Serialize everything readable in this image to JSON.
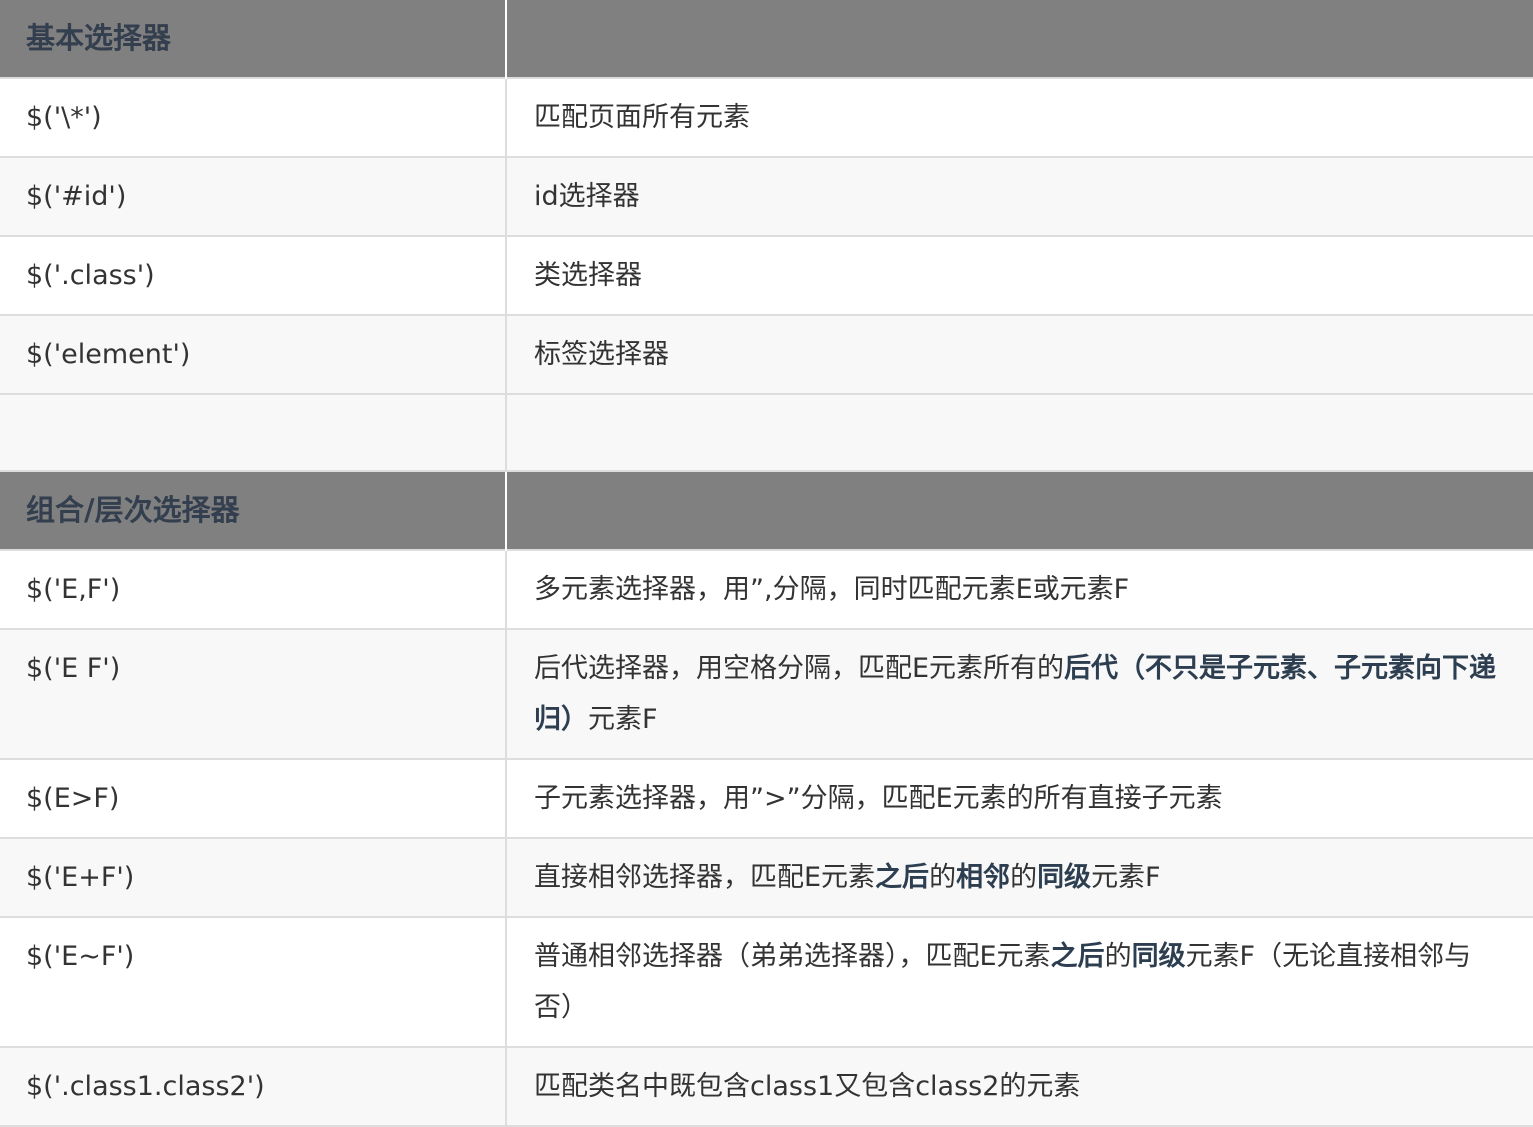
{
  "sections": [
    {
      "title": "基本选择器",
      "rows": [
        {
          "selector": "$('\\*')",
          "description": [
            {
              "text": "匹配页面所有元素",
              "bold": false
            }
          ]
        },
        {
          "selector": "$('#id')",
          "description": [
            {
              "text": "id选择器",
              "bold": false
            }
          ]
        },
        {
          "selector": "$('.class')",
          "description": [
            {
              "text": "类选择器",
              "bold": false
            }
          ]
        },
        {
          "selector": "$('element')",
          "description": [
            {
              "text": "标签选择器",
              "bold": false
            }
          ]
        }
      ]
    },
    {
      "title": "组合/层次选择器",
      "rows": [
        {
          "selector": "$('E,F')",
          "description": [
            {
              "text": "多元素选择器，用”,分隔，同时匹配元素E或元素F",
              "bold": false
            }
          ]
        },
        {
          "selector": "$('E F')",
          "description": [
            {
              "text": "后代选择器，用空格分隔，匹配E元素所有的",
              "bold": false
            },
            {
              "text": "后代（不只是子元素、子元素向下递归）",
              "bold": true
            },
            {
              "text": "元素F",
              "bold": false
            }
          ]
        },
        {
          "selector": "$(E>F)",
          "description": [
            {
              "text": "子元素选择器，用”>”分隔，匹配E元素的所有直接子元素",
              "bold": false
            }
          ]
        },
        {
          "selector": "$('E+F')",
          "description": [
            {
              "text": "直接相邻选择器，匹配E元素",
              "bold": false
            },
            {
              "text": "之后",
              "bold": true
            },
            {
              "text": "的",
              "bold": false
            },
            {
              "text": "相邻",
              "bold": true
            },
            {
              "text": "的",
              "bold": false
            },
            {
              "text": "同级",
              "bold": true
            },
            {
              "text": "元素F",
              "bold": false
            }
          ]
        },
        {
          "selector": "$('E~F')",
          "description": [
            {
              "text": "普通相邻选择器（弟弟选择器），匹配E元素",
              "bold": false
            },
            {
              "text": "之后",
              "bold": true
            },
            {
              "text": "的",
              "bold": false
            },
            {
              "text": "同级",
              "bold": true
            },
            {
              "text": "元素F（无论直接相邻与否）",
              "bold": false
            }
          ]
        },
        {
          "selector": "$('.class1.class2')",
          "description": [
            {
              "text": "匹配类名中既包含class1又包含class2的元素",
              "bold": false
            }
          ]
        }
      ]
    }
  ]
}
